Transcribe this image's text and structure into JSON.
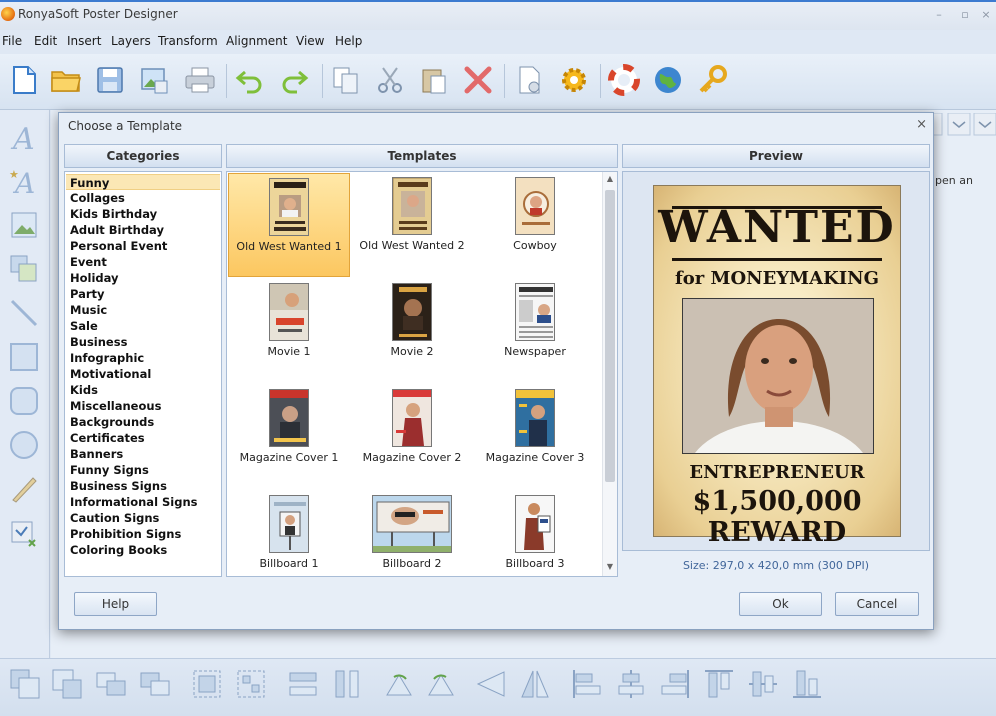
{
  "app": {
    "title": "RonyaSoft Poster Designer",
    "minimize": "–",
    "maximize": "▫",
    "close": "×"
  },
  "menu": [
    "File",
    "Edit",
    "Insert",
    "Layers",
    "Transform",
    "Alignment",
    "View",
    "Help"
  ],
  "dialog": {
    "title": "Choose a Template",
    "close": "×",
    "headers": {
      "categories": "Categories",
      "templates": "Templates",
      "preview": "Preview"
    },
    "categories": [
      "Funny",
      "Collages",
      "Kids Birthday",
      "Adult Birthday",
      "Personal Event",
      "Event",
      "Holiday",
      "Party",
      "Music",
      "Sale",
      "Business",
      "Infographic",
      "Motivational",
      "Kids",
      "Miscellaneous",
      "Backgrounds",
      "Certificates",
      "Banners",
      "Funny Signs",
      "Business Signs",
      "Informational Signs",
      "Caution Signs",
      "Prohibition Signs",
      "Coloring Books"
    ],
    "selected_category": "Funny",
    "templates": [
      "Old West Wanted 1",
      "Old West Wanted 2",
      "Cowboy",
      "Movie 1",
      "Movie 2",
      "Newspaper",
      "Magazine Cover 1",
      "Magazine Cover 2",
      "Magazine Cover 3",
      "Billboard 1",
      "Billboard 2",
      "Billboard 3"
    ],
    "selected_template": "Old West Wanted 1",
    "poster": {
      "title": "WANTED",
      "subtitle": "for MONEYMAKING",
      "caption": "ENTREPRENEUR",
      "reward": "$1,500,000 REWARD"
    },
    "size": "Size: 297,0 x 420,0 mm (300 DPI)",
    "buttons": {
      "help": "Help",
      "ok": "Ok",
      "cancel": "Cancel"
    }
  },
  "workspace": {
    "hint": "pen an"
  },
  "colors": {
    "accent": "#3d7bd0",
    "selection": "#fcc760",
    "panel_border": "#a8bcd6"
  }
}
